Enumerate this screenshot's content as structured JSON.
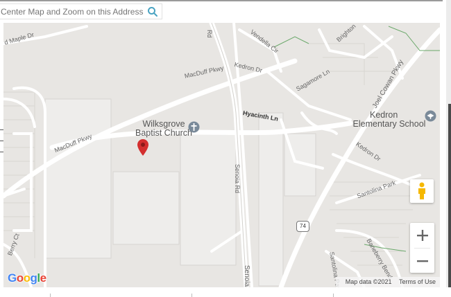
{
  "search": {
    "placeholder": "Center Map and Zoom on this Address",
    "icon": "search-icon",
    "accent": "#4aa3c2"
  },
  "map": {
    "roads": {
      "maple": "d Maple Dr",
      "rd_top": "Rd",
      "vendella": "Vendella Cir",
      "brighton": "Brighton",
      "kedron_top": "Kedron Dr",
      "macduff_top": "MacDuff Pkwy",
      "sagamore": "Sagamore Ln",
      "joel_cowan": "Joel Cowan Pkwy",
      "hyacinth": "Hyacinth Ln",
      "macduff_left": "MacDuff Pkwy",
      "kedron_right": "Kedron Dr",
      "senoia_mid": "Senoia Rd",
      "santolina": "Santolina Park",
      "highway": "74",
      "berry": "Berry Ct",
      "baneberry": "Baneberry Bend",
      "santolina_park_v": "Santolina Park",
      "senoia_bottom": "Senoia"
    },
    "poi": {
      "church": "Wilksgrove Baptist Church",
      "church_line1": "Wilksgrove",
      "church_line2": "Baptist Church",
      "school_line1": "Kedron",
      "school_line2": "Elementary School"
    },
    "controls": {
      "zoom_in": "+",
      "zoom_out": "−"
    },
    "logo": "Google",
    "attribution": {
      "map_data": "Map data ©2021",
      "terms": "Terms of Use"
    },
    "colors": {
      "marker": "#d32f2f",
      "pegman": "#f5b800",
      "poi_icon": "#7a8a99"
    }
  }
}
